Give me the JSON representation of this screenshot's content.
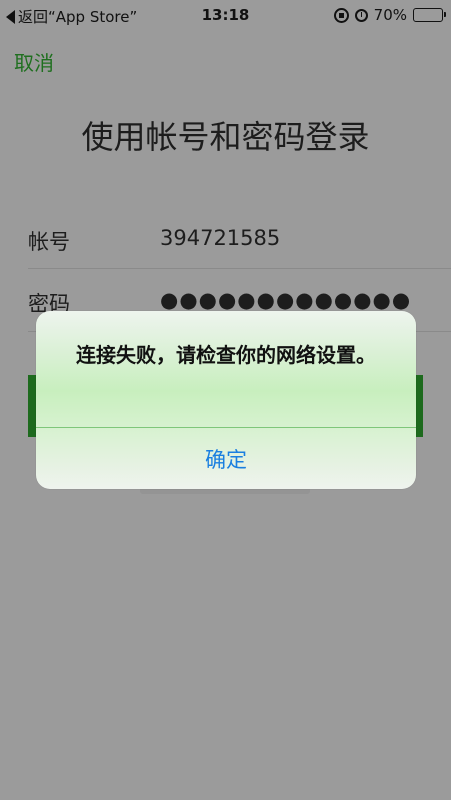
{
  "status_bar": {
    "back_label": "返回“App Store”",
    "time": "13:18",
    "battery": "70%",
    "battery_level": 0.7
  },
  "nav": {
    "cancel_label": "取消"
  },
  "page": {
    "title": "使用帐号和密码登录"
  },
  "form": {
    "account_label": "帐号",
    "account_value": "394721585",
    "password_label": "密码",
    "password_value": "●●●●●●●●●●●●●"
  },
  "alert": {
    "message": "连接失败，请检查你的网络设置。",
    "confirm_label": "确定"
  },
  "colors": {
    "accent_green": "#1f6f1f",
    "button_blue": "#1a7fe0",
    "dim_background": "#9b9b9b"
  }
}
